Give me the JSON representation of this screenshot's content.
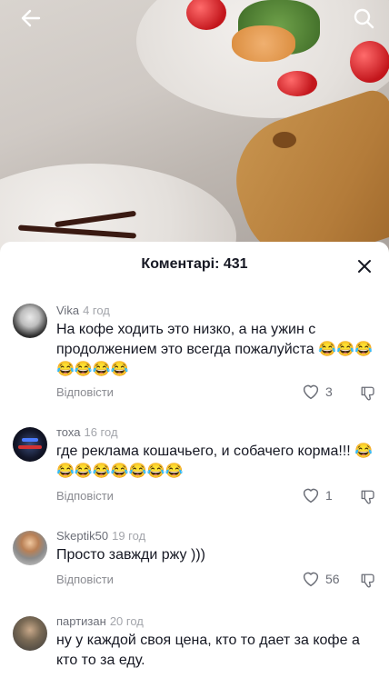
{
  "header": {
    "back_icon": "arrow-left-icon",
    "search_icon": "search-icon"
  },
  "comments_sheet": {
    "title": "Коментарі: 431",
    "close_icon": "close-icon",
    "reply_label": "Відповісти",
    "comments": [
      {
        "username": "Vika",
        "time": "4 год",
        "text": "На кофе ходить это низко, а на ужин с продолжением это всегда пожалуйста 😂😂😂😂😂😂😂",
        "likes": "3"
      },
      {
        "username": "тоха",
        "time": "16 год",
        "text": "где реклама кошачьего, и собачего корма!!! 😂😂😂😂😂😂😂😂",
        "likes": "1"
      },
      {
        "username": "Skeptik50",
        "time": "19 год",
        "text": "Просто завжди ржу )))",
        "likes": "56"
      },
      {
        "username": "партизан",
        "time": "20 год",
        "text": "ну у каждой своя цена, кто то дает за кофе а кто то за еду.",
        "likes": ""
      }
    ]
  },
  "colors": {
    "text_primary": "#161823",
    "text_secondary": "#8a8b91",
    "sheet_bg": "#ffffff"
  }
}
